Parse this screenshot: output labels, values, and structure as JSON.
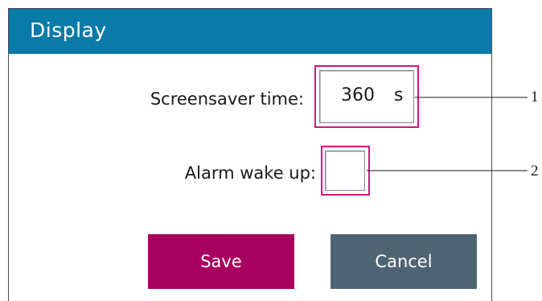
{
  "dialog": {
    "title": "Display",
    "colors": {
      "titlebar": "#0a7aa8",
      "highlight": "#d6157a",
      "save_button": "#a8005e",
      "cancel_button": "#4f6473"
    }
  },
  "screensaver": {
    "label": "Screensaver time:",
    "value": "360",
    "unit": "s"
  },
  "alarm_wake_up": {
    "label": "Alarm wake up:",
    "checked": false
  },
  "buttons": {
    "save_label": "Save",
    "cancel_label": "Cancel"
  },
  "callouts": {
    "one": "1",
    "two": "2"
  }
}
